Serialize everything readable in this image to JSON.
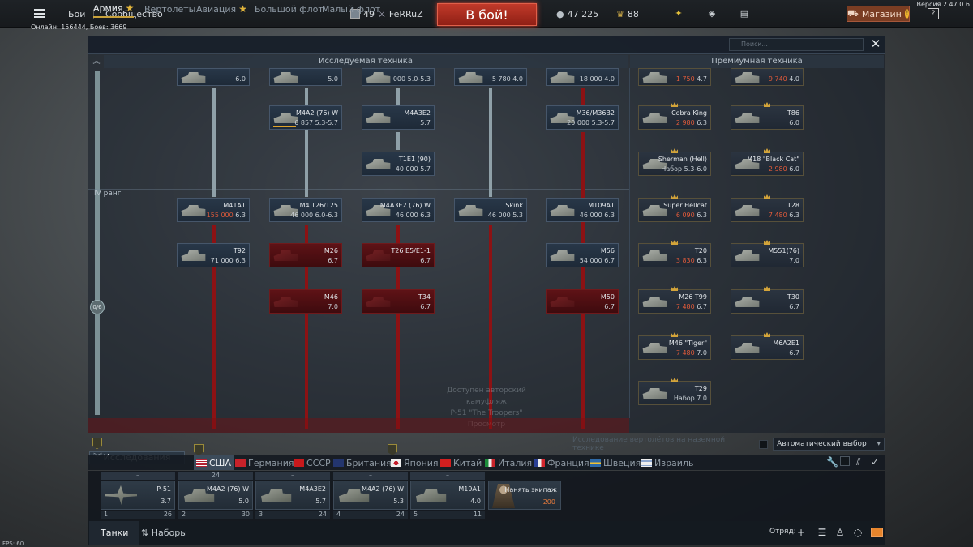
{
  "topbar": {
    "menu_items": [
      "Бои",
      "Сообщество"
    ],
    "online": "Онлайн: 156444, Боев: 3669",
    "version": "Версия 2.47.0.6",
    "rank": "49",
    "nickname": "FeRRuZ",
    "battle_label": "В бой!",
    "silver": "47 225",
    "gold": "88",
    "shop_label": "Магазин"
  },
  "tabs": [
    {
      "label": "Армия",
      "active": true
    },
    {
      "label": "Вертолёты"
    },
    {
      "label": "Авиация"
    },
    {
      "label": "Большой флот"
    },
    {
      "label": "Малый флот"
    }
  ],
  "search": {
    "placeholder": "Поиск..."
  },
  "headers": {
    "research": "Исследуемая техника",
    "premium": "Премиумная техника"
  },
  "rank_label": "IV ранг",
  "rank_progress": "0/6",
  "tree": [
    {
      "name": "",
      "stats": "6.0"
    },
    {
      "name": "",
      "stats": "5.0"
    },
    {
      "name": "",
      "stats": "000 5.0-5.3"
    },
    {
      "name": "",
      "stats": "5 780 4.0"
    },
    {
      "name": "",
      "stats": "18 000 4.0"
    },
    {
      "name": "M4A2 (76) W",
      "stats": "6 857 5.3-5.7"
    },
    {
      "name": "M4A3E2",
      "stats": "5.7"
    },
    {
      "name": "M36/M36B2",
      "stats": "20 000 5.3-5.7"
    },
    {
      "name": "T1E1 (90)",
      "stats": "40 000 5.7"
    },
    {
      "name": "M41A1",
      "stats_a": "155 000",
      "stats_b": " 6.3"
    },
    {
      "name": "M4 T26/T25",
      "stats": "46 000 6.0-6.3"
    },
    {
      "name": "M4A3E2 (76) W",
      "stats": "46 000 6.3"
    },
    {
      "name": "Skink",
      "stats": "46 000 5.3"
    },
    {
      "name": "M109A1",
      "stats": "46 000 6.3"
    },
    {
      "name": "T92",
      "stats": "71 000 6.3"
    },
    {
      "name": "M26",
      "stats": "6.7"
    },
    {
      "name": "T26 E5/E1-1",
      "stats": "6.7"
    },
    {
      "name": "M56",
      "stats": "54 000 6.7"
    },
    {
      "name": "M46",
      "stats": "7.0"
    },
    {
      "name": "T34",
      "stats": "6.7"
    },
    {
      "name": "M50",
      "stats": "6.7"
    }
  ],
  "premium": [
    {
      "name": "",
      "stats_a": "1 750",
      "stats_b": " 4.7"
    },
    {
      "name": "",
      "stats_a": "9 740",
      "stats_b": " 4.0"
    },
    {
      "name": "Cobra King",
      "stats_a": "2 980",
      "stats_b": " 6.3"
    },
    {
      "name": "T86",
      "stats_a": "",
      "stats_b": "6.0"
    },
    {
      "name": "Sherman (Hell)",
      "stats_a": "",
      "stats_b": "Набор 5.3-6.0"
    },
    {
      "name": "M18 \"Black Cat\"",
      "stats_a": "2 980",
      "stats_b": " 6.0"
    },
    {
      "name": "Super Hellcat",
      "stats_a": "6 090",
      "stats_b": " 6.3"
    },
    {
      "name": "T28",
      "stats_a": "7 480",
      "stats_b": " 6.3"
    },
    {
      "name": "T20",
      "stats_a": "3 830",
      "stats_b": " 6.3"
    },
    {
      "name": "M551(76)",
      "stats_a": "",
      "stats_b": "7.0"
    },
    {
      "name": "M26 T99",
      "stats_a": "7 480",
      "stats_b": " 6.7"
    },
    {
      "name": "T30",
      "stats_a": "",
      "stats_b": "6.7"
    },
    {
      "name": "M46 \"Tiger\"",
      "stats_a": "7 480",
      "stats_b": " 7.0"
    },
    {
      "name": "M6A2E1",
      "stats_a": "",
      "stats_b": "6.7"
    },
    {
      "name": "T29",
      "stats_a": "",
      "stats_b": "Набор 7.0"
    }
  ],
  "ghost_text": [
    "Доступен авторский камуфляж",
    "P-51 \"The Troopers\"",
    "Просмотр"
  ],
  "heli_research": {
    "label": "Исследование вертолётов на наземной технике",
    "select": "Автоматический выбор"
  },
  "research_button": "Исследования",
  "nations": [
    {
      "label": "США",
      "active": true
    },
    {
      "label": "Германия"
    },
    {
      "label": "СССР"
    },
    {
      "label": "Британия"
    },
    {
      "label": "Япония"
    },
    {
      "label": "Китай"
    },
    {
      "label": "Италия"
    },
    {
      "label": "Франция"
    },
    {
      "label": "Швеция"
    },
    {
      "label": "Израиль"
    }
  ],
  "slots": [
    {
      "top": "–",
      "name": "P-51",
      "br": "3.7",
      "num": "1",
      "right": "26"
    },
    {
      "top": "24",
      "name": "M4A2 (76) W",
      "br": "5.0",
      "num": "2",
      "right": "30"
    },
    {
      "top": "–",
      "name": "M4A3E2",
      "br": "5.7",
      "num": "3",
      "right": "24"
    },
    {
      "top": "–",
      "name": "M4A2 (76) W",
      "br": "5.3",
      "num": "4",
      "right": "24"
    },
    {
      "top": "–",
      "name": "M19A1",
      "br": "4.0",
      "num": "5",
      "right": "11"
    }
  ],
  "hire": {
    "label": "Нанять экипаж",
    "cost": "200"
  },
  "bottom": {
    "tab_tanks": "Танки",
    "tab_sets": "Наборы",
    "squad": "Отряд:"
  },
  "fps": "FPS: 60",
  "colors": {
    "battle": "#c13a2a",
    "shop": "#7a3d23",
    "accent": "#c9a23b",
    "red_tree": "#8c1214"
  }
}
